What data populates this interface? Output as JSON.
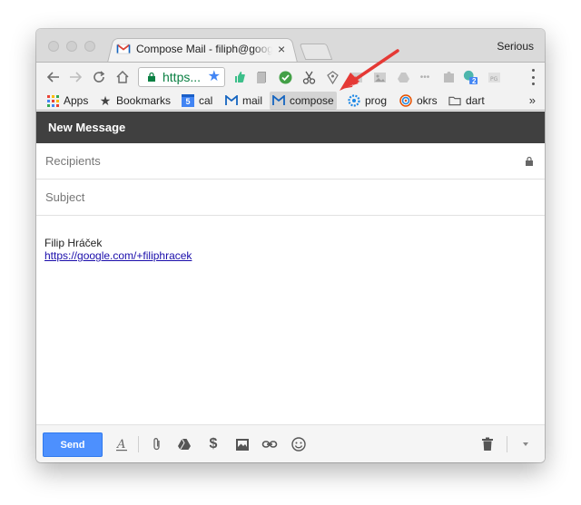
{
  "window": {
    "tab_title": "Compose Mail - filiph@google.com",
    "tab_close": "×",
    "profile_name": "Serious"
  },
  "toolbar": {
    "url_text": "https...",
    "back_icon": "arrow-left-icon",
    "forward_icon": "arrow-right-icon",
    "reload_icon": "reload-icon",
    "home_icon": "home-icon",
    "extensions_count_badge": "2"
  },
  "bookmarks": {
    "items": [
      {
        "label": "Apps",
        "icon": "apps-grid-icon"
      },
      {
        "label": "Bookmarks",
        "icon": "star-icon"
      },
      {
        "label": "cal",
        "icon": "calendar-icon"
      },
      {
        "label": "mail",
        "icon": "gmail-icon"
      },
      {
        "label": "compose",
        "icon": "gmail-icon"
      },
      {
        "label": "prog",
        "icon": "gear-flower-icon"
      },
      {
        "label": "okrs",
        "icon": "target-icon"
      },
      {
        "label": "dart",
        "icon": "folder-icon"
      }
    ],
    "overflow": "»",
    "calendar_day": "5"
  },
  "compose": {
    "header_title": "New Message",
    "recipients_placeholder": "Recipients",
    "subject_placeholder": "Subject",
    "signature_name": "Filip Hráček",
    "signature_link": "https://google.com/+filiphracek",
    "send_label": "Send"
  },
  "colors": {
    "header_bg": "#404040",
    "send_button": "#4d90fe",
    "link": "#1a0dab",
    "url_green": "#0b8043",
    "annotation_arrow": "#e53935"
  }
}
